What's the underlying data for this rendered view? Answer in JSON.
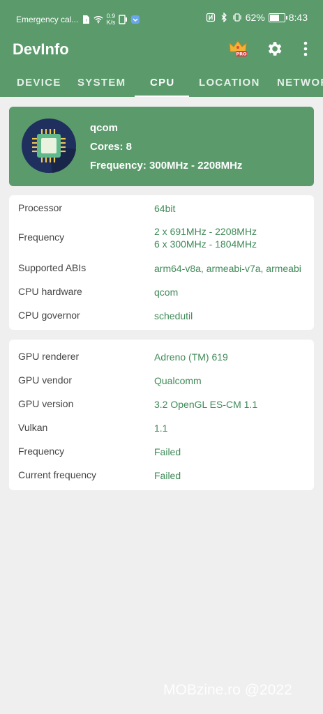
{
  "status_bar": {
    "carrier": "Emergency cal...",
    "speed_value": "0.9",
    "speed_unit": "K/s",
    "battery": "62%",
    "time": "8:43"
  },
  "app_bar": {
    "title": "DevInfo",
    "icons": [
      "crown-pro-icon",
      "gear-icon",
      "more-vert-icon"
    ],
    "pro_badge": "PRO"
  },
  "tabs": [
    {
      "label": "DEVICE",
      "active": false
    },
    {
      "label": "SYSTEM",
      "active": false
    },
    {
      "label": "CPU",
      "active": true
    },
    {
      "label": "LOCATION",
      "active": false
    },
    {
      "label": "NETWORK",
      "active": false
    }
  ],
  "hero": {
    "vendor": "qcom",
    "cores": "Cores: 8",
    "frequency": "Frequency: 300MHz - 2208MHz"
  },
  "cpu_card": {
    "rows": [
      {
        "key": "Processor",
        "value": "64bit"
      },
      {
        "key": "Frequency",
        "value": "2 x 691MHz - 2208MHz",
        "value2": "6 x 300MHz - 1804MHz"
      },
      {
        "key": "Supported ABIs",
        "value": "arm64-v8a, armeabi-v7a, armeabi"
      },
      {
        "key": "CPU hardware",
        "value": "qcom"
      },
      {
        "key": "CPU governor",
        "value": "schedutil"
      }
    ]
  },
  "gpu_card": {
    "rows": [
      {
        "key": "GPU renderer",
        "value": "Adreno (TM) 619"
      },
      {
        "key": "GPU vendor",
        "value": "Qualcomm"
      },
      {
        "key": "GPU version",
        "value": "3.2 OpenGL ES-CM 1.1"
      },
      {
        "key": "Vulkan",
        "value": "1.1"
      },
      {
        "key": "Frequency",
        "value": "Failed"
      },
      {
        "key": "Current frequency",
        "value": "Failed"
      }
    ]
  },
  "watermark": "MOBzine.ro @2022",
  "colors": {
    "primary": "#5a9a6b",
    "value_text": "#3f8a57",
    "background": "#efefef"
  }
}
